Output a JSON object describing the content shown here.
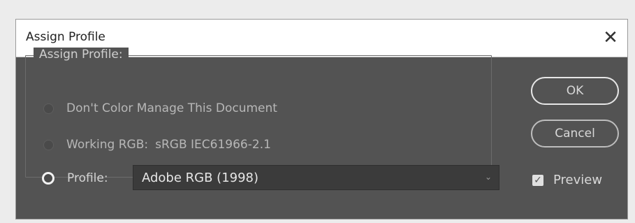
{
  "window": {
    "title": "Assign Profile",
    "close_symbol": "✕"
  },
  "group": {
    "title": "Assign Profile:"
  },
  "options": {
    "dont_manage": "Don't Color Manage This Document",
    "working_rgb_label": "Working RGB:",
    "working_rgb_value": "sRGB IEC61966-2.1",
    "profile_label": "Profile:"
  },
  "profile_select": {
    "selected": "Adobe RGB (1998)",
    "chevron": "⌄"
  },
  "buttons": {
    "ok": "OK",
    "cancel": "Cancel"
  },
  "preview": {
    "label": "Preview",
    "checked": true,
    "check_symbol": "✓"
  }
}
